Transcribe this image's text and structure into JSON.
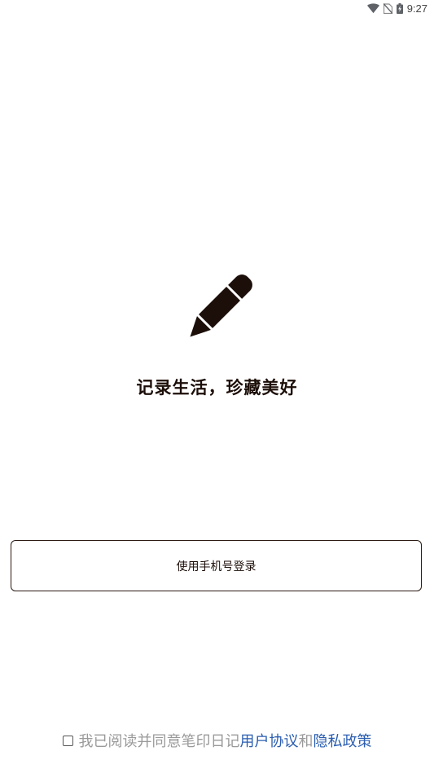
{
  "status_bar": {
    "time": "9:27",
    "icons": [
      "wifi-icon",
      "no-sim-icon",
      "battery-charging-icon"
    ]
  },
  "hero": {
    "icon": "pencil-icon",
    "slogan": "记录生活，珍藏美好"
  },
  "login": {
    "phone_button_label": "使用手机号登录"
  },
  "agreement": {
    "prefix": "我已阅读并同意笔印日记",
    "user_agreement": "用户协议",
    "connector": "和",
    "privacy_policy": "隐私政策"
  },
  "colors": {
    "icon": "#1c0e08",
    "link": "#2a5db0",
    "muted_text": "#9a9a9a"
  }
}
